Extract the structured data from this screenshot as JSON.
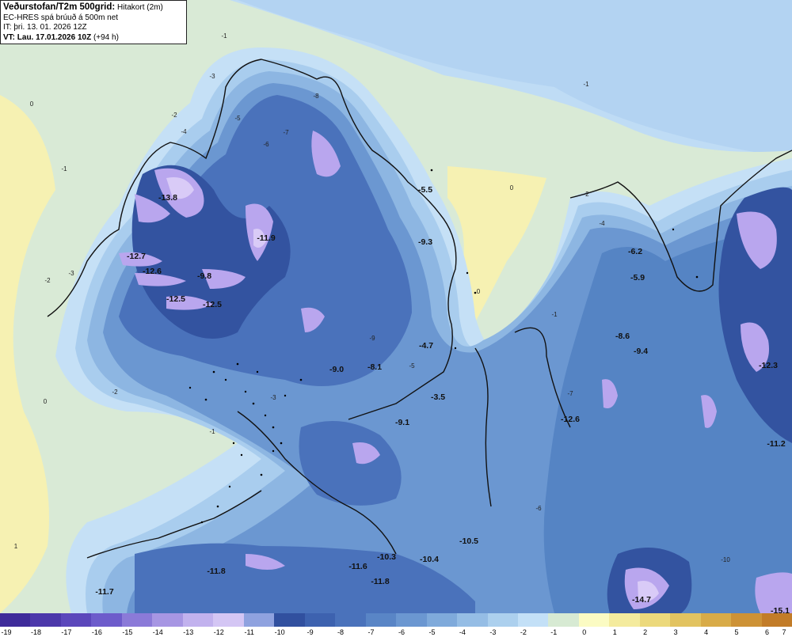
{
  "header": {
    "title": "Veðurstofan/T2m 500grid:",
    "subtitle": "Hitakort (2m)",
    "model": "EC-HRES spá brúuð á 500m net",
    "init_time": "IT: þri. 13. 01. 2026 12Z",
    "valid_time": "VT: Lau. 17.01.2026 10Z",
    "lead": "(+94 h)"
  },
  "legend": {
    "ticks": [
      "-19",
      "-18",
      "-17",
      "-16",
      "-15",
      "-14",
      "-13",
      "-12",
      "-11",
      "-10",
      "-9",
      "-8",
      "-7",
      "-6",
      "-5",
      "-4",
      "-3",
      "-2",
      "-1",
      "0",
      "1",
      "2",
      "3",
      "4",
      "5",
      "6",
      "7"
    ],
    "colors": [
      "#3e2b9a",
      "#4c38aa",
      "#5b47bb",
      "#6d5ccb",
      "#8b7ad8",
      "#a796e3",
      "#c2b2ee",
      "#d4c6f4",
      "#8fa2df",
      "#31509f",
      "#3d62af",
      "#4a72bb",
      "#5985c6",
      "#6b97d1",
      "#7faadb",
      "#95bde5",
      "#acd0ee",
      "#c3e0f7",
      "#d7ead3",
      "#fbfbc3",
      "#f4eb9e",
      "#ecd97c",
      "#e2c360",
      "#d8ab48",
      "#cd9236",
      "#c27c28"
    ]
  },
  "map_labels": {
    "values": [
      {
        "text": "-13.8",
        "kind": "extreme"
      },
      {
        "text": "-11.9",
        "kind": "extreme"
      },
      {
        "text": "-12.7",
        "kind": "extreme"
      },
      {
        "text": "-12.6",
        "kind": "extreme"
      },
      {
        "text": "-9.8",
        "kind": "extreme"
      },
      {
        "text": "-12.5",
        "kind": "extreme"
      },
      {
        "text": "-12.5",
        "kind": "extreme"
      },
      {
        "text": "-9.3",
        "kind": "extreme"
      },
      {
        "text": "-5.5",
        "kind": "extreme"
      },
      {
        "text": "-9.0",
        "kind": "extreme"
      },
      {
        "text": "-8.1",
        "kind": "extreme"
      },
      {
        "text": "-4.7",
        "kind": "extreme"
      },
      {
        "text": "-3.5",
        "kind": "extreme"
      },
      {
        "text": "-9.1",
        "kind": "extreme"
      },
      {
        "text": "-6.2",
        "kind": "extreme"
      },
      {
        "text": "-5.9",
        "kind": "extreme"
      },
      {
        "text": "-8.6",
        "kind": "extreme"
      },
      {
        "text": "-9.4",
        "kind": "extreme"
      },
      {
        "text": "-12.3",
        "kind": "extreme"
      },
      {
        "text": "-12.6",
        "kind": "extreme"
      },
      {
        "text": "-11.2",
        "kind": "extreme"
      },
      {
        "text": "-10.5",
        "kind": "extreme"
      },
      {
        "text": "-10.3",
        "kind": "extreme"
      },
      {
        "text": "-10.4",
        "kind": "extreme"
      },
      {
        "text": "-11.6",
        "kind": "extreme"
      },
      {
        "text": "-11.8",
        "kind": "extreme"
      },
      {
        "text": "-11.8",
        "kind": "extreme"
      },
      {
        "text": "-11.7",
        "kind": "extreme"
      },
      {
        "text": "-14.7",
        "kind": "extreme"
      },
      {
        "text": "-15.1",
        "kind": "extreme"
      },
      {
        "text": "0",
        "kind": "contour"
      },
      {
        "text": "0",
        "kind": "contour"
      },
      {
        "text": "0",
        "kind": "contour"
      },
      {
        "text": "0",
        "kind": "contour"
      },
      {
        "text": "-1",
        "kind": "contour"
      },
      {
        "text": "-1",
        "kind": "contour"
      },
      {
        "text": "-1",
        "kind": "contour"
      },
      {
        "text": "-1",
        "kind": "contour"
      },
      {
        "text": "-1",
        "kind": "contour"
      },
      {
        "text": "-2",
        "kind": "contour"
      },
      {
        "text": "-2",
        "kind": "contour"
      },
      {
        "text": "-2",
        "kind": "contour"
      },
      {
        "text": "-2",
        "kind": "contour"
      },
      {
        "text": "-3",
        "kind": "contour"
      },
      {
        "text": "-3",
        "kind": "contour"
      },
      {
        "text": "-3",
        "kind": "contour"
      },
      {
        "text": "-4",
        "kind": "contour"
      },
      {
        "text": "-4",
        "kind": "contour"
      },
      {
        "text": "-5",
        "kind": "contour"
      },
      {
        "text": "-5",
        "kind": "contour"
      },
      {
        "text": "-6",
        "kind": "contour"
      },
      {
        "text": "-6",
        "kind": "contour"
      },
      {
        "text": "-7",
        "kind": "contour"
      },
      {
        "text": "-7",
        "kind": "contour"
      },
      {
        "text": "-8",
        "kind": "contour"
      },
      {
        "text": "-9",
        "kind": "contour"
      },
      {
        "text": "-10",
        "kind": "contour"
      },
      {
        "text": "1",
        "kind": "contour"
      }
    ]
  }
}
